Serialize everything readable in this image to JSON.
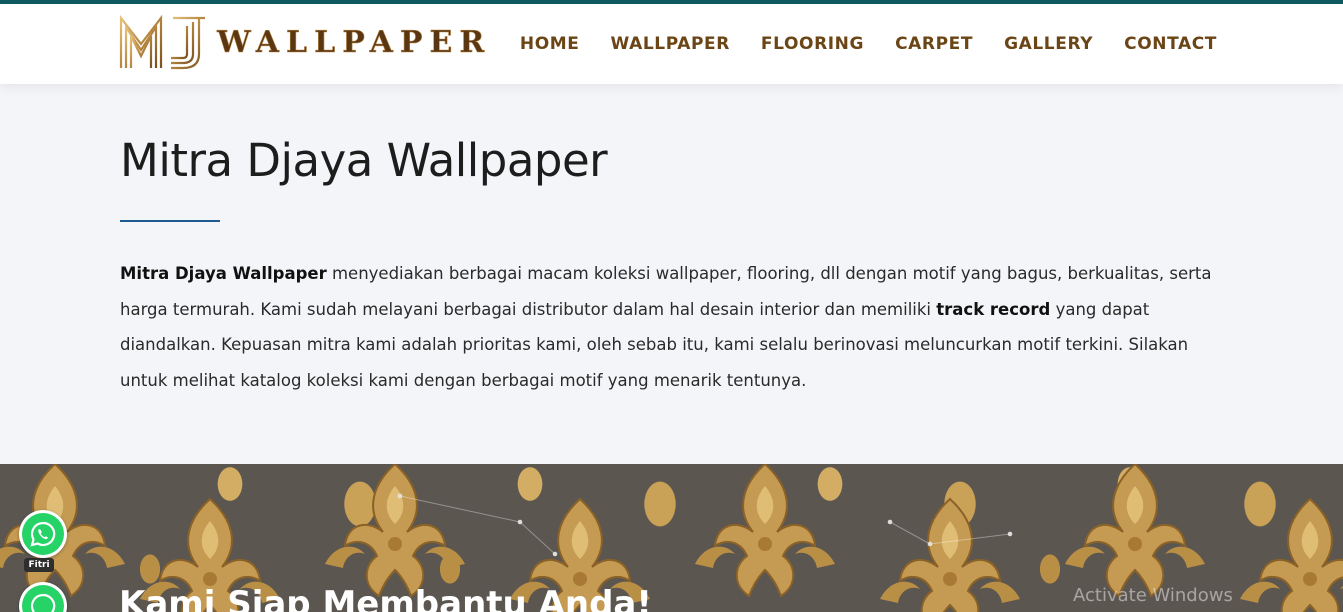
{
  "brand": {
    "logo_text": "WALLPAPER",
    "logo_mark": "MJ"
  },
  "nav": {
    "items": [
      {
        "label": "HOME"
      },
      {
        "label": "WALLPAPER"
      },
      {
        "label": "FLOORING"
      },
      {
        "label": "CARPET"
      },
      {
        "label": "GALLERY"
      },
      {
        "label": "CONTACT"
      }
    ]
  },
  "main": {
    "title": "Mitra Djaya Wallpaper",
    "intro": {
      "bold_brand": "Mitra Djaya Wallpaper",
      "text_1": " menyediakan berbagai macam koleksi wallpaper, flooring, dll dengan motif yang bagus, berkualitas, serta harga termurah. Kami sudah melayani berbagai distributor dalam hal desain interior dan memiliki ",
      "bold_track": "track record",
      "text_2": " yang dapat diandalkan. Kepuasan mitra kami adalah prioritas kami, oleh sebab itu, kami selalu berinovasi meluncurkan motif terkini. Silakan untuk melihat katalog koleksi kami dengan berbagai motif yang menarik tentunya."
    }
  },
  "banner": {
    "title": "Kami Siap Membantu Anda!"
  },
  "whatsapp": {
    "agent_label": "Fitri"
  },
  "os_watermark": "Activate Windows",
  "colors": {
    "top_line": "#0e5a5e",
    "nav_text": "#6b4516",
    "divider": "#1f5a8f",
    "whatsapp_green": "#25d366"
  }
}
